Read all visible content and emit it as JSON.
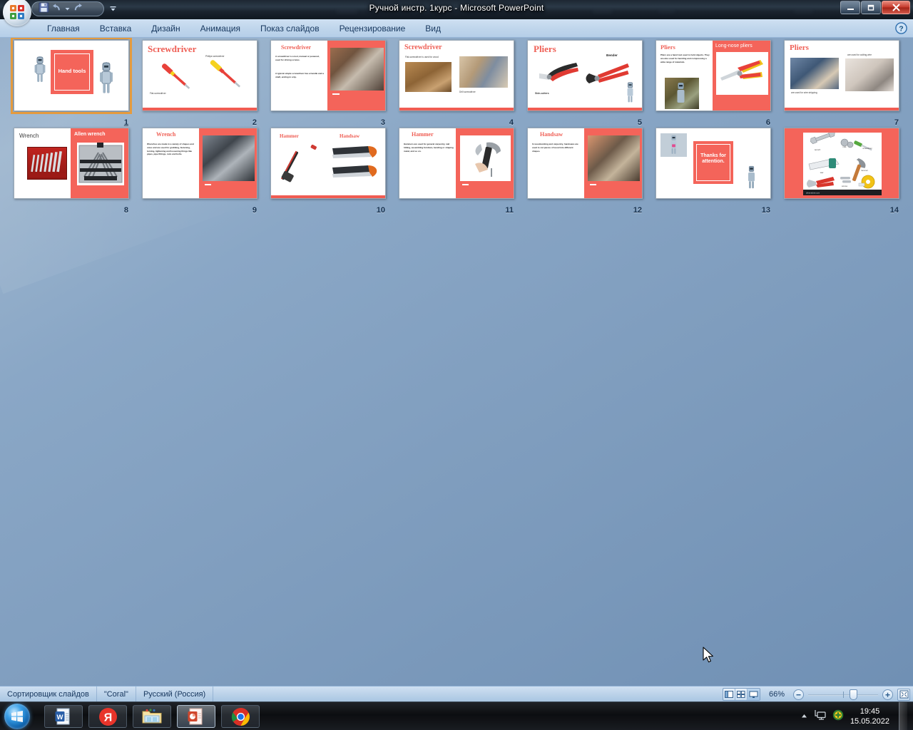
{
  "window": {
    "title": "Ручной инстр. 1курс - Microsoft PowerPoint",
    "minimize_label": "Свернуть",
    "maximize_label": "Восстановить",
    "close_label": "Закрыть",
    "office_button_label": "Office",
    "quick_access": [
      {
        "name": "save-icon",
        "label": "Сохранить"
      },
      {
        "name": "undo-icon",
        "label": "Отменить"
      },
      {
        "name": "undo-dropdown-icon",
        "label": "Отменить список"
      },
      {
        "name": "redo-icon",
        "label": "Вернуть"
      }
    ],
    "qat_customize_label": "Настройка панели быстрого доступа",
    "help_label": "Справка"
  },
  "ribbon": {
    "tabs": [
      {
        "label": "Главная",
        "active": false
      },
      {
        "label": "Вставка",
        "active": false
      },
      {
        "label": "Дизайн",
        "active": false
      },
      {
        "label": "Анимация",
        "active": false
      },
      {
        "label": "Показ слайдов",
        "active": false
      },
      {
        "label": "Рецензирование",
        "active": false
      },
      {
        "label": "Вид",
        "active": true
      }
    ]
  },
  "slides": [
    {
      "num": "1",
      "title": "Hand tools",
      "layout": "title-box",
      "selected": true
    },
    {
      "num": "2",
      "title": "Screwdriver",
      "layout": "two-tools",
      "captions": [
        "Flat-screwdriver",
        "Philips screwdriver"
      ]
    },
    {
      "num": "3",
      "title": "Screwdriver",
      "layout": "text-photo-right",
      "body": [
        "A screwdriver is a tool, manual or powered, used for driving screws.",
        "A typical simple screwdriver has a handle and a shaft, ending in a tip."
      ]
    },
    {
      "num": "4",
      "title": "Screwdriver",
      "layout": "two-photos",
      "captions": [
        "Flat-screwdriver is used for wood",
        "Drill screwdriver"
      ]
    },
    {
      "num": "5",
      "title": "Pliers",
      "layout": "pliers-pair",
      "captions": [
        "Side-cutters",
        "Bender"
      ]
    },
    {
      "num": "6",
      "title": "Pliers",
      "layout": "text-photo-red",
      "panel_title": "Long-nose pliers",
      "body": [
        "Pliers are a hand tool used to hold objects. They are also used for bending and compressing a wide range of materials."
      ]
    },
    {
      "num": "7",
      "title": "Pliers",
      "layout": "two-photos",
      "captions": [
        "are used for wire stripping",
        "are used for cutting wire"
      ]
    },
    {
      "num": "8",
      "title": "Wrench",
      "layout": "two-panel-title",
      "panel_title": "Allen wrench"
    },
    {
      "num": "9",
      "title": "Wrench",
      "layout": "text-photo-red",
      "body": [
        "Wrenches are made in a variety of shapes and sizes and are used for grabbing, fastening, turning, tightening and loosening things like pipes, pipe fittings, nuts and bolts."
      ]
    },
    {
      "num": "10",
      "title": "Hammer",
      "layout": "two-tools",
      "captions": [
        "Hammer",
        "Handsaw"
      ]
    },
    {
      "num": "11",
      "title": "Hammer",
      "layout": "text-photo-red",
      "body": [
        "Hammers are used for general carpentry, nail hitting, assembling furniture, bending or shaping metal, and so on."
      ]
    },
    {
      "num": "12",
      "title": "Handsaw",
      "layout": "text-photo-red",
      "body": [
        "In woodworking and carpentry, handsaws are used to cut pieces of wood into different shapes."
      ]
    },
    {
      "num": "13",
      "title": "Thanks for attention.",
      "layout": "thanks"
    },
    {
      "num": "14",
      "title": "",
      "layout": "tools-poster",
      "captions": [
        "wrench",
        "nuts",
        "screwdriver",
        "saw",
        "screws",
        "hammer",
        "pliers",
        "tape measure"
      ]
    }
  ],
  "statusbar": {
    "view_name": "Сортировщик слайдов",
    "theme_name": "\"Coral\"",
    "language": "Русский (Россия)",
    "zoom_level": "66%",
    "view_buttons": [
      {
        "name": "normal-view-button",
        "label": "Обычный"
      },
      {
        "name": "slide-sorter-view-button",
        "label": "Сортировщик слайдов"
      },
      {
        "name": "slideshow-view-button",
        "label": "Показ слайдов",
        "active": true
      }
    ],
    "zoom_out_label": "Уменьшить",
    "zoom_in_label": "Увеличить",
    "fit_label": "Вписать слайд в текущее окно"
  },
  "taskbar": {
    "start_label": "Пуск",
    "items": [
      {
        "name": "taskbar-word",
        "label": "Microsoft Word",
        "active": false
      },
      {
        "name": "taskbar-yandex",
        "label": "Яндекс.Браузер",
        "active": false
      },
      {
        "name": "taskbar-explorer",
        "label": "Проводник",
        "active": false
      },
      {
        "name": "taskbar-powerpoint",
        "label": "Microsoft PowerPoint",
        "active": true
      },
      {
        "name": "taskbar-chrome",
        "label": "Google Chrome",
        "active": false
      }
    ],
    "tray": [
      {
        "name": "show-hidden-icons-icon",
        "label": "Отображать скрытые значки"
      },
      {
        "name": "network-icon",
        "label": "Сеть"
      },
      {
        "name": "antivirus-icon",
        "label": "Антивирус"
      }
    ],
    "clock_time": "19:45",
    "clock_date": "15.05.2022",
    "show_desktop_label": "Свернуть все окна"
  },
  "colors": {
    "accent_red": "#f4645a",
    "title_red": "#ef5f55",
    "selection_orange": "#e59b3e",
    "ribbon_blue": "#c0d6ec"
  }
}
